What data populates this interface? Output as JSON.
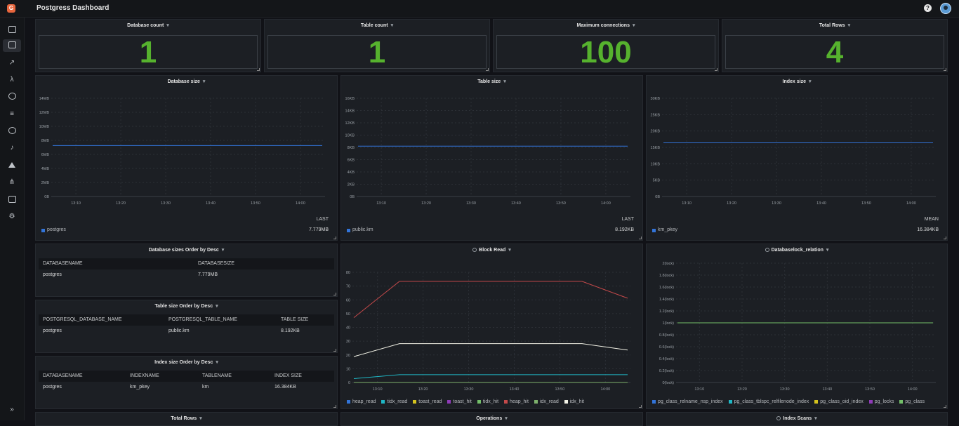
{
  "header": {
    "title": "Postgress Dashboard",
    "logo": "grafana-logo-icon",
    "help": "?",
    "user": "user-avatar-icon"
  },
  "sidebar": {
    "items": [
      "home-icon",
      "dashboards-icon",
      "explore-icon",
      "lambda-icon",
      "search-icon",
      "logs-icon",
      "bug-icon",
      "alerts-bell-icon",
      "alarm-icon",
      "topology-icon",
      "monitor-icon",
      "settings-gear-icon"
    ],
    "expand": "»"
  },
  "stats": [
    {
      "title": "Database count",
      "value": "1"
    },
    {
      "title": "Table count",
      "value": "1"
    },
    {
      "title": "Maximum connections",
      "value": "100"
    },
    {
      "title": "Total Rows",
      "value": "4"
    }
  ],
  "size_charts": [
    {
      "title": "Database size",
      "chart_data": {
        "type": "line",
        "x": [
          "13:10",
          "13:20",
          "13:30",
          "13:40",
          "13:50",
          "14:00"
        ],
        "yticks": [
          "0B",
          "2MB",
          "4MB",
          "6MB",
          "8MB",
          "10MB",
          "12MB",
          "14MB"
        ],
        "ylim": [
          0,
          15
        ],
        "series": [
          {
            "name": "postgres",
            "values": [
              7.779,
              7.779,
              7.779,
              7.779,
              7.779,
              7.779
            ]
          }
        ],
        "legend_header": "LAST",
        "legend_value": "7.779MB"
      }
    },
    {
      "title": "Table size",
      "chart_data": {
        "type": "line",
        "x": [
          "13:10",
          "13:20",
          "13:30",
          "13:40",
          "13:50",
          "14:00"
        ],
        "yticks": [
          "0B",
          "2KB",
          "4KB",
          "6KB",
          "8KB",
          "10KB",
          "12KB",
          "14KB",
          "16KB"
        ],
        "ylim": [
          0,
          16
        ],
        "series": [
          {
            "name": "public.km",
            "values": [
              8.192,
              8.192,
              8.192,
              8.192,
              8.192,
              8.192
            ]
          }
        ],
        "legend_header": "LAST",
        "legend_value": "8.192KB"
      }
    },
    {
      "title": "Index size",
      "chart_data": {
        "type": "line",
        "x": [
          "13:10",
          "13:20",
          "13:30",
          "13:40",
          "13:50",
          "14:00"
        ],
        "yticks": [
          "0B",
          "5KB",
          "10KB",
          "15KB",
          "20KB",
          "25KB",
          "30KB"
        ],
        "ylim": [
          0,
          30
        ],
        "series": [
          {
            "name": "km_pkey",
            "values": [
              16.384,
              16.384,
              16.384,
              16.384,
              16.384,
              16.384
            ]
          }
        ],
        "legend_header": "MEAN",
        "legend_value": "16.384KB"
      }
    }
  ],
  "tables": [
    {
      "title": "Database sizes Order by Desc",
      "columns": [
        "DATABASENAME",
        "DATABASESIZE"
      ],
      "rows": [
        [
          "postgres",
          "7.779MB"
        ]
      ]
    },
    {
      "title": "Table size Order by Desc",
      "columns": [
        "POSTGRESQL_DATABASE_NAME",
        "POSTGRESQL_TABLE_NAME",
        "TABLE SIZE"
      ],
      "rows": [
        [
          "postgres",
          "public.km",
          "8.192KB"
        ]
      ]
    },
    {
      "title": "Index size Order by Desc",
      "columns": [
        "DATABASENAME",
        "INDEXNAME",
        "TABLENAME",
        "INDEX SIZE"
      ],
      "rows": [
        [
          "postgres",
          "km_pkey",
          "km",
          "16.384KB"
        ]
      ]
    }
  ],
  "block_read": {
    "title": "Block Read",
    "chart_data": {
      "type": "line",
      "x": [
        "13:10",
        "13:20",
        "13:30",
        "13:40",
        "13:50",
        "14:00"
      ],
      "yticks": [
        "0",
        "10",
        "20",
        "30",
        "40",
        "50",
        "60",
        "70",
        "80"
      ],
      "ylim": [
        0,
        85
      ],
      "series": [
        {
          "name": "heap_read",
          "color": "#3274d9",
          "values": [
            0,
            0,
            0,
            0,
            0,
            0,
            0
          ]
        },
        {
          "name": "tidx_read",
          "color": "#1fb7c5",
          "values": [
            3,
            6,
            6,
            6,
            6,
            6,
            6
          ]
        },
        {
          "name": "toast_read",
          "color": "#d4c31e",
          "values": [
            0,
            0,
            0,
            0,
            0,
            0,
            0
          ]
        },
        {
          "name": "toast_hit",
          "color": "#8f3bb8",
          "values": [
            0,
            0,
            0,
            0,
            0,
            0,
            0
          ]
        },
        {
          "name": "tidx_hit",
          "color": "#73bf69",
          "values": [
            0,
            0,
            0,
            0,
            0,
            0,
            0
          ]
        },
        {
          "name": "heap_hit",
          "color": "#c4494a",
          "values": [
            50,
            78,
            78,
            78,
            78,
            78,
            65
          ]
        },
        {
          "name": "idx_read",
          "color": "#7eb26d",
          "values": [
            0,
            0,
            0,
            0,
            0,
            0,
            0
          ]
        },
        {
          "name": "idx_hit",
          "color": "#f2f2e6",
          "values": [
            20,
            30,
            30,
            30,
            30,
            30,
            25
          ]
        }
      ]
    }
  },
  "lock_relation": {
    "title": "Databaselock_relation",
    "chart_data": {
      "type": "line",
      "x": [
        "13:10",
        "13:20",
        "13:30",
        "13:40",
        "13:50",
        "14:00"
      ],
      "yticks": [
        "0(lock)",
        "0.2(lock)",
        "0.4(lock)",
        "0.6(lock)",
        "0.8(lock)",
        "1(lock)",
        "1.2(lock)",
        "1.4(lock)",
        "1.6(lock)",
        "1.8(lock)",
        "2(lock)"
      ],
      "ylim": [
        0,
        2
      ],
      "series": [
        {
          "name": "pg_class_relname_nsp_index",
          "color": "#3274d9",
          "values": [
            1,
            1,
            1,
            1,
            1,
            1
          ]
        },
        {
          "name": "pg_class_tblspc_relfilenode_index",
          "color": "#1fb7c5",
          "values": [
            1,
            1,
            1,
            1,
            1,
            1
          ]
        },
        {
          "name": "pg_class_oid_index",
          "color": "#d4c31e",
          "values": [
            1,
            1,
            1,
            1,
            1,
            1
          ]
        },
        {
          "name": "pg_locks",
          "color": "#8f3bb8",
          "values": [
            1,
            1,
            1,
            1,
            1,
            1
          ]
        },
        {
          "name": "pg_class",
          "color": "#73bf69",
          "values": [
            1,
            1,
            1,
            1,
            1,
            1
          ]
        }
      ]
    }
  },
  "bottom_panels": [
    "Total Rows",
    "Operations",
    "Index Scans"
  ]
}
